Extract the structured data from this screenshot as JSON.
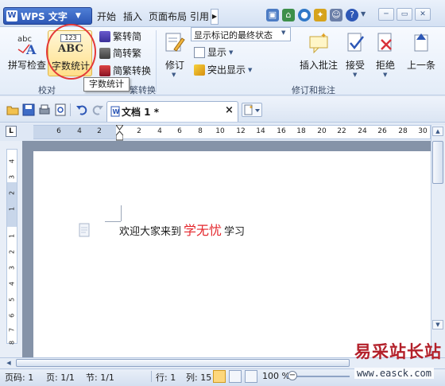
{
  "app": {
    "menu_button": "WPS 文字",
    "tabs": [
      "开始",
      "插入",
      "页面布局",
      "引用"
    ]
  },
  "ribbon": {
    "proofing": {
      "spell_check": "拼写检查",
      "word_count": "字数统计",
      "word_count_icon_text": "ABC",
      "word_count_icon_num": "123",
      "group_label": "校对"
    },
    "conversion": {
      "trad_to_simp": "繁转简",
      "simp_to_trad": "简转繁",
      "convert": "简繁转换",
      "group_label_partial": "繁转换"
    },
    "tracking": {
      "track_changes": "修订",
      "markup_dropdown": "显示标记的最终状态",
      "show": "显示",
      "highlight": "突出显示",
      "insert_comment": "插入批注",
      "accept": "接受",
      "reject": "拒绝",
      "previous": "上一条",
      "group_label": "修订和批注"
    },
    "tooltip": "字数统计"
  },
  "document_tabs": {
    "active_tab": "文档 1 *",
    "close_glyph": "×"
  },
  "rulers": {
    "horizontal_ticks": [
      "6",
      "4",
      "2",
      "2",
      "4",
      "6",
      "8",
      "10",
      "12",
      "14",
      "16",
      "18",
      "20",
      "22",
      "24",
      "26",
      "28",
      "30"
    ],
    "vertical_ticks": [
      "4",
      "3",
      "2",
      "1",
      "1",
      "2",
      "3",
      "4",
      "5",
      "6",
      "7",
      "8"
    ],
    "corner": "L"
  },
  "document": {
    "text_before": "欢迎大家来到",
    "brand_word": "学无忧",
    "text_after": "学习",
    "brand_color": "#e4262c"
  },
  "status_bar": {
    "page_code": "页码: 1",
    "page": "页: 1/1",
    "section": "节: 1/1",
    "row": "行: 1",
    "column": "列: 15",
    "zoom": "100 %"
  },
  "watermark": {
    "title": "易采站长站",
    "url": "www.easck.com"
  },
  "icons": {
    "wps_logo": "W",
    "up_arrow": "▲",
    "down_arrow": "▼",
    "left_arrow": "◀"
  }
}
